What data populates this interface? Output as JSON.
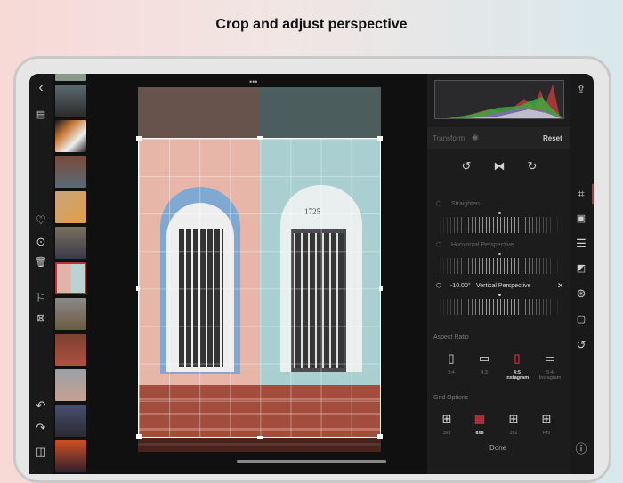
{
  "title": "Crop and adjust perspective",
  "transform": {
    "label": "Transform",
    "reset": "Reset"
  },
  "sliders": [
    {
      "label": "Straighten"
    },
    {
      "label": "Horizontal Perspective"
    },
    {
      "label": "Vertical Perspective",
      "value": "-10.00°"
    }
  ],
  "aspect": {
    "label": "Aspect Ratio",
    "options": [
      {
        "name": "3:4",
        "sub": ""
      },
      {
        "name": "4:3",
        "sub": ""
      },
      {
        "name": "4:5",
        "sub": "Instagram",
        "selected": true
      },
      {
        "name": "5:4",
        "sub": "Instagram"
      }
    ]
  },
  "grid": {
    "label": "Grid Options",
    "options": [
      {
        "name": "3x3"
      },
      {
        "name": "8x8",
        "selected": true
      },
      {
        "name": "2x2"
      },
      {
        "name": "Phi"
      }
    ]
  },
  "done": "Done",
  "photo": {
    "sign": "1725"
  },
  "colors": {
    "accent": "#b8303d",
    "panel": "#1c1c1d"
  }
}
